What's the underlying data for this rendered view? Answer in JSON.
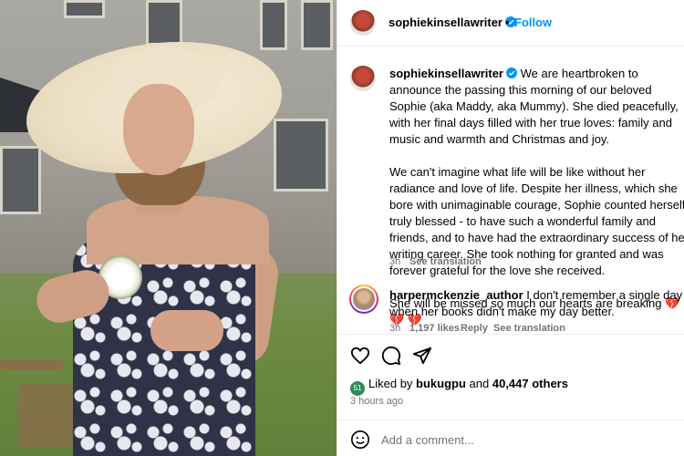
{
  "header": {
    "username": "sophiekinsellawriter",
    "dot": "•",
    "follow_label": "Follow"
  },
  "caption": {
    "username": "sophiekinsellawriter",
    "text": " We are heartbroken to announce the passing this morning of our beloved Sophie (aka Maddy, aka Mummy). She died peacefully, with her final days filled with her true loves: family and music and warmth and Christmas and joy.\n\nWe can't imagine what life will be like without her radiance and love of life. Despite her illness, which she bore with unimaginable courage, Sophie counted herself truly blessed - to have such a wonderful family and friends, and to have had the extraordinary success of her writing career. She took nothing for granted and was forever grateful for the love she received.\n\nShe will be missed so much our hearts are breaking 💔 💔 💔",
    "time": "3h",
    "see_translation": "See translation"
  },
  "comment": {
    "username": "harpermckenzie_author",
    "text": " I don't remember a single day when her books didn't make my day better.",
    "time": "3h",
    "likes": "1,197 likes",
    "reply": "Reply",
    "see_translation": "See translation"
  },
  "actions": {
    "icons": [
      "heart-icon",
      "comment-icon",
      "share-icon"
    ]
  },
  "likes": {
    "prefix": "Liked by ",
    "user": "bukugpu",
    "and": " and ",
    "others": "40,447 others",
    "avatar_label": "51"
  },
  "posted": "3 hours ago",
  "add_comment": {
    "placeholder": "Add a comment..."
  },
  "colors": {
    "accent": "#0095f6",
    "muted": "#737373",
    "divider": "#efefef"
  }
}
